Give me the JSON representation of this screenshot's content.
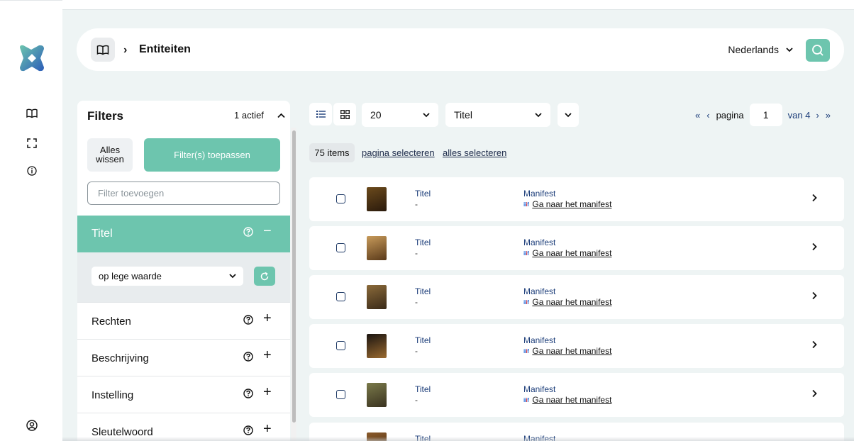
{
  "colors": {
    "accent": "#6dc5ae",
    "text_dark": "#111111",
    "link_blue": "#1d3e7a",
    "background": "#eef4f4"
  },
  "header": {
    "home_icon": "book-open-icon",
    "separator": "›",
    "breadcrumb_title": "Entiteiten",
    "language": "Nederlands",
    "search_icon": "search-icon"
  },
  "rail": {
    "items": [
      {
        "name": "entities",
        "icon": "book-open-icon"
      },
      {
        "name": "fullscreen",
        "icon": "expand-corners-icon"
      },
      {
        "name": "info",
        "icon": "info-icon"
      },
      {
        "name": "account",
        "icon": "user-circle-icon"
      }
    ]
  },
  "filters": {
    "title": "Filters",
    "active_count": "1 actief",
    "clear_label": "Alles wissen",
    "apply_label": "Filter(s) toepassen",
    "add_placeholder": "Filter toevoegen",
    "expanded": {
      "label": "Titel",
      "operator": "op lege waarde"
    },
    "collapsed": [
      {
        "label": "Rechten"
      },
      {
        "label": "Beschrijving"
      },
      {
        "label": "Instelling"
      },
      {
        "label": "Sleutelwoord"
      }
    ]
  },
  "toolbar": {
    "page_size": "20",
    "sort_field": "Titel",
    "pager": {
      "first": "«",
      "prev": "‹",
      "label": "pagina",
      "current": "1",
      "of_label": "van 4",
      "next": "›",
      "last": "»"
    },
    "item_count": "75 items",
    "select_page": "pagina selecteren",
    "select_all": "alles selecteren"
  },
  "rows": [
    {
      "title_label": "Titel",
      "title_value": "-",
      "manifest_label": "Manifest",
      "manifest_link": "Ga naar het manifest",
      "thumb_colors": [
        "#6b4a1c",
        "#2a1a0c"
      ]
    },
    {
      "title_label": "Titel",
      "title_value": "-",
      "manifest_label": "Manifest",
      "manifest_link": "Ga naar het manifest",
      "thumb_colors": [
        "#c79a5a",
        "#5a3a1a"
      ]
    },
    {
      "title_label": "Titel",
      "title_value": "-",
      "manifest_label": "Manifest",
      "manifest_link": "Ga naar het manifest",
      "thumb_colors": [
        "#8a6a3a",
        "#3a2a18"
      ]
    },
    {
      "title_label": "Titel",
      "title_value": "-",
      "manifest_label": "Manifest",
      "manifest_link": "Ga naar het manifest",
      "thumb_colors": [
        "#1a1410",
        "#9a6a30"
      ]
    },
    {
      "title_label": "Titel",
      "title_value": "-",
      "manifest_label": "Manifest",
      "manifest_link": "Ga naar het manifest",
      "thumb_colors": [
        "#7a7a4a",
        "#3a3220"
      ]
    },
    {
      "title_label": "Titel",
      "title_value": "",
      "manifest_label": "Manifest",
      "manifest_link": "",
      "thumb_colors": [
        "#8a5a2a",
        "#4a2e14"
      ]
    }
  ]
}
